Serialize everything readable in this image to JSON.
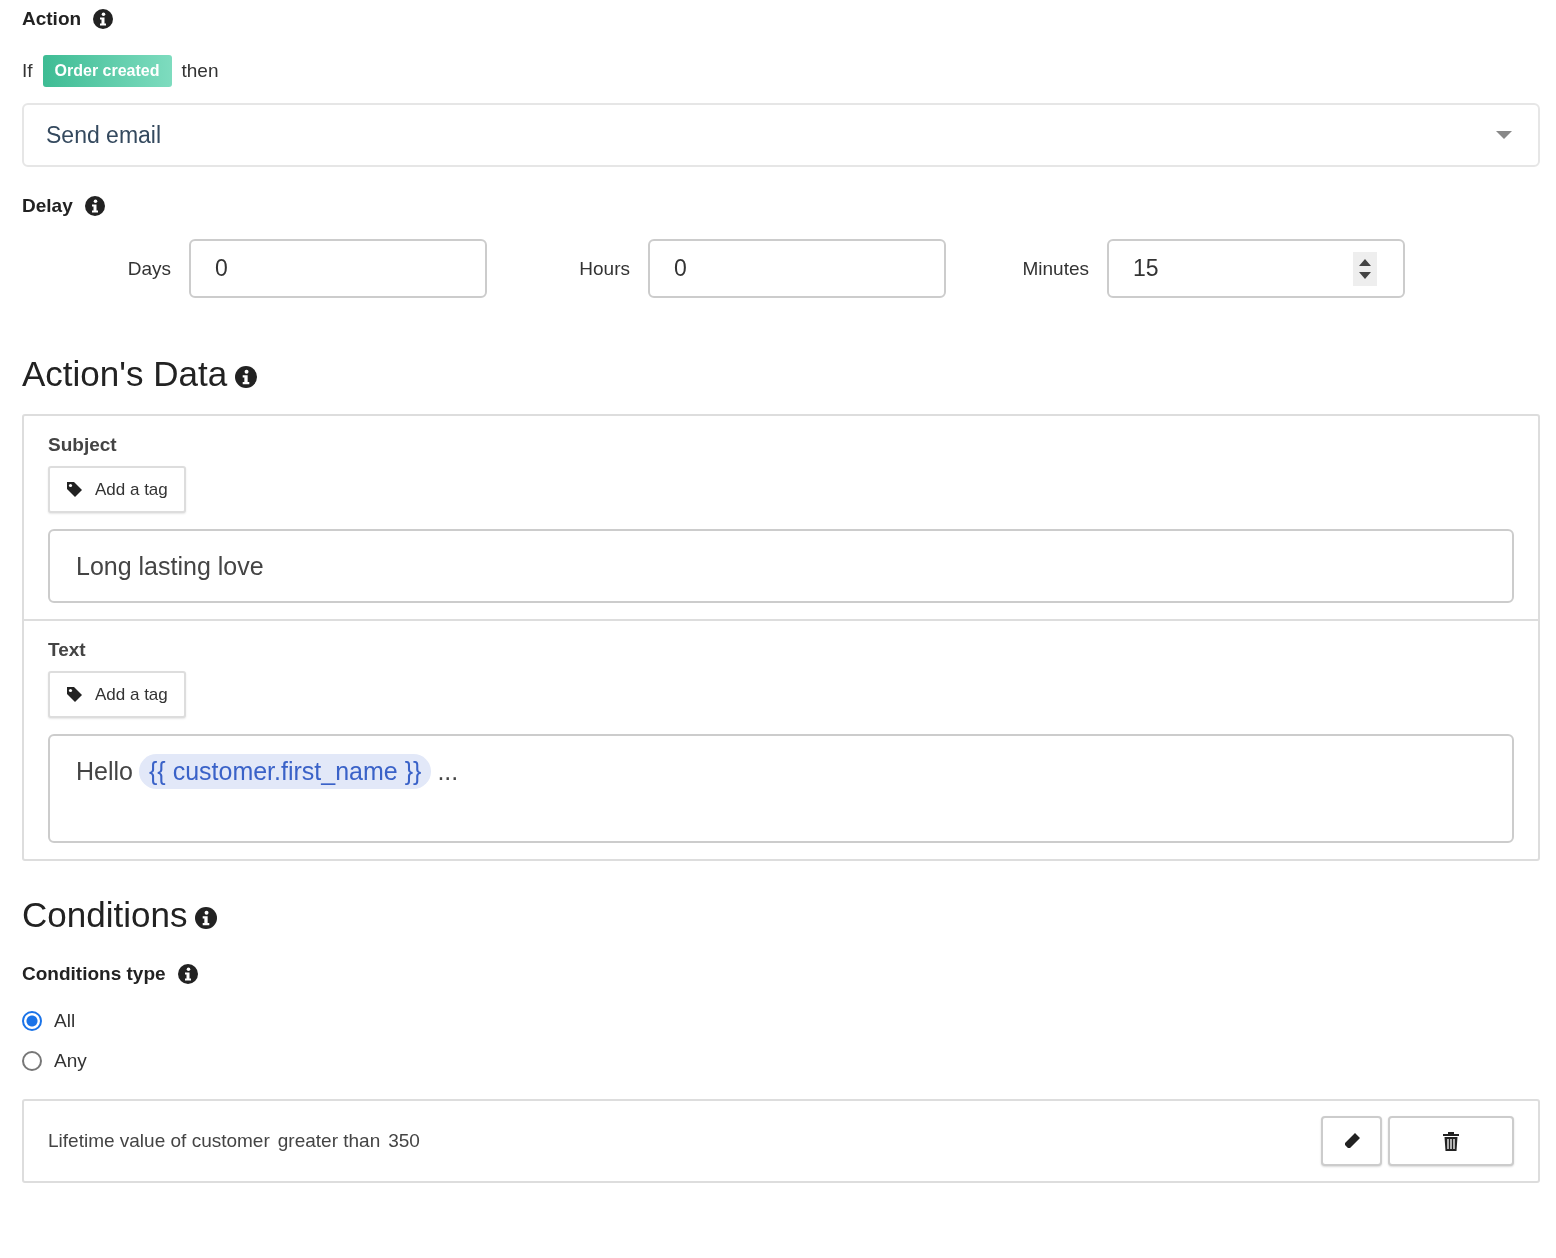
{
  "action": {
    "label": "Action",
    "if_word": "If",
    "trigger": "Order created",
    "then_word": "then",
    "select": {
      "value": "Send email"
    }
  },
  "delay": {
    "label": "Delay",
    "fields": [
      {
        "label": "Days",
        "value": "0",
        "kind": "text"
      },
      {
        "label": "Hours",
        "value": "0",
        "kind": "text"
      },
      {
        "label": "Minutes",
        "value": "15",
        "kind": "spinner"
      }
    ]
  },
  "actions_data": {
    "heading": "Action's Data",
    "sections": [
      {
        "label": "Subject",
        "tag_button": "Add a tag",
        "kind": "input",
        "value": "Long lasting love"
      },
      {
        "label": "Text",
        "tag_button": "Add a tag",
        "kind": "textarea",
        "before": "Hello",
        "variable": "{{ customer.first_name }}",
        "after": "..."
      }
    ]
  },
  "conditions": {
    "heading": "Conditions",
    "type_label": "Conditions type",
    "options": [
      {
        "label": "All",
        "selected": true
      },
      {
        "label": "Any",
        "selected": false
      }
    ],
    "rules": [
      {
        "parts": [
          "Lifetime value of customer",
          "greater than",
          "350"
        ]
      }
    ]
  }
}
